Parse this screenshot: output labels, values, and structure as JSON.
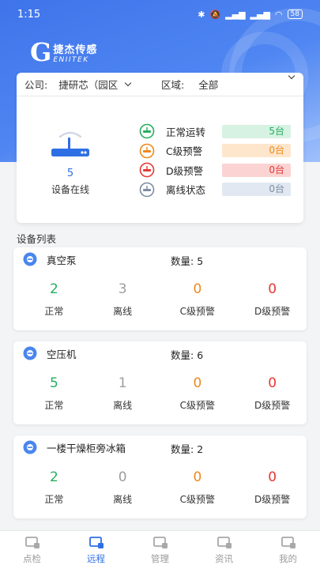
{
  "status_bar": {
    "time": "1:15",
    "battery": "58"
  },
  "logo": {
    "mark": "G",
    "cn": "捷杰传感",
    "en": "ENIITEK"
  },
  "filters": {
    "company_label": "公司:",
    "company_value": "捷研芯（园区",
    "area_label": "区域:",
    "area_value": "全部"
  },
  "online": {
    "count": "5",
    "label": "设备在线"
  },
  "statuses": [
    {
      "name": "正常运转",
      "count": "5台",
      "color": "#27ae60",
      "bg": "#d7f2e3",
      "icon": "normal-status-icon"
    },
    {
      "name": "C级预警",
      "count": "0台",
      "color": "#ee8a1c",
      "bg": "#fde6cc",
      "icon": "c-warning-icon"
    },
    {
      "name": "D级预警",
      "count": "0台",
      "color": "#e53935",
      "bg": "#fbd3d3",
      "icon": "d-warning-icon"
    },
    {
      "name": "离线状态",
      "count": "0台",
      "color": "#7d8da3",
      "bg": "#e1e8f1",
      "icon": "offline-status-icon"
    }
  ],
  "section_title": "设备列表",
  "qty_label": "数量:",
  "stat_labels": [
    "正常",
    "离线",
    "C级预警",
    "D级预警"
  ],
  "stat_colors": [
    "#27ae60",
    "#9e9e9e",
    "#ee8a1c",
    "#e53935"
  ],
  "devices": [
    {
      "name": "真空泵",
      "qty": "5",
      "stats": [
        "2",
        "3",
        "0",
        "0"
      ]
    },
    {
      "name": "空压机",
      "qty": "6",
      "stats": [
        "5",
        "1",
        "0",
        "0"
      ]
    },
    {
      "name": "一楼干燥柜旁冰箱",
      "qty": "2",
      "stats": [
        "2",
        "0",
        "0",
        "0"
      ]
    }
  ],
  "nav": [
    {
      "label": "点检",
      "icon": "inspection-icon",
      "active": false
    },
    {
      "label": "远程",
      "icon": "remote-icon",
      "active": true
    },
    {
      "label": "管理",
      "icon": "manage-icon",
      "active": false
    },
    {
      "label": "资讯",
      "icon": "news-icon",
      "active": false
    },
    {
      "label": "我的",
      "icon": "profile-icon",
      "active": false
    }
  ],
  "colors": {
    "primary": "#2f6fe4",
    "header": "#4a80ef"
  }
}
